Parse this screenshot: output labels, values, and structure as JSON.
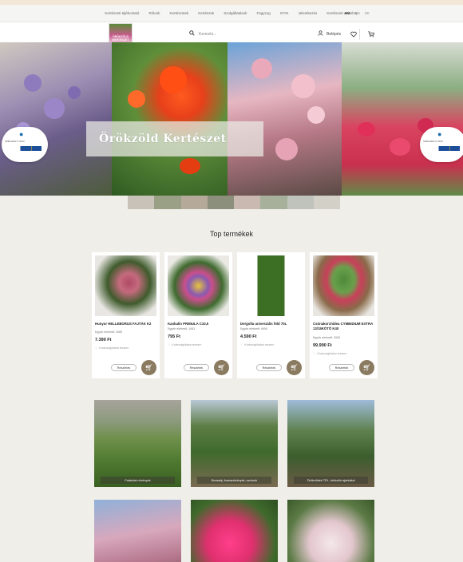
{
  "topnav": {
    "links": [
      "Kertészeti tájékoztató",
      "Rólunk",
      "Kertészetek",
      "Kertészek",
      "Szolgáltatások",
      "Fagyzug",
      "GYIK",
      "Jelentkezés",
      "Kertészeti webshop"
    ],
    "langs": [
      "HU",
      "EN",
      "DE"
    ]
  },
  "header": {
    "logo_text": "ÖRÖKZÖLD KERTÉSZET",
    "search_placeholder": "Keresés...",
    "login_label": "Belépés"
  },
  "hero": {
    "title": "Örökzöld Kertészet",
    "badge_text": "SZÉCHENYI 2020"
  },
  "colors": {
    "accent": "#8a7a60",
    "background": "#efeee9"
  },
  "top_products": {
    "title": "Top termékek",
    "more_label": "Részletek",
    "favorite_label": "Kívánságlistára teszem",
    "items": [
      {
        "name": "Hunyor HELLEBORUS FAJTÁK K2",
        "stock": "Egyéb elérhető: 3085",
        "price": "7.390 Ft"
      },
      {
        "name": "Kankalin PRIMULA C10,5",
        "stock": "Egyéb elérhető: 1083",
        "price": "795 Ft"
      },
      {
        "name": "Dergolla univerzális föld 70L",
        "stock": "Egyéb elérhető: 6950",
        "price": "4.590 Ft"
      },
      {
        "name": "Csónakorchidea CYMBIDIUM EXTRA 13/15KÖTŐ K40",
        "stock": "Egyéb elérhető: 2060",
        "price": "99.990 Ft"
      }
    ]
  },
  "categories": [
    {
      "label": "Faiskolai növények"
    },
    {
      "label": "Bonszáj, formanövények, szobrok"
    },
    {
      "label": "Örökzöldek TÉL, örökzöld ajánlattal"
    },
    {
      "label": ""
    },
    {
      "label": ""
    },
    {
      "label": ""
    }
  ]
}
